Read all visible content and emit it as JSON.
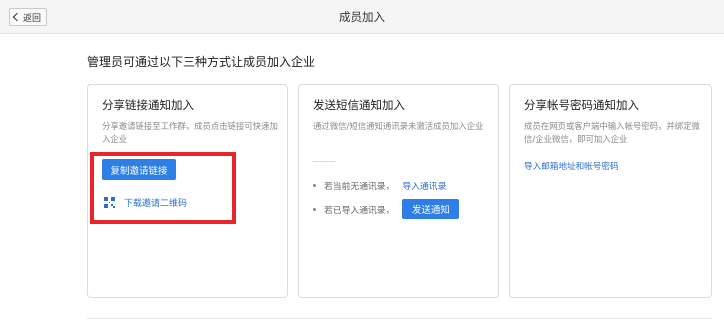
{
  "topbar": {
    "back_label": "返回",
    "title": "成员加入"
  },
  "heading": "管理员可通过以下三种方式让成员加入企业",
  "cards": [
    {
      "title": "分享链接通知加入",
      "desc": "分享邀请链接至工作群，成员点击链接可快速加入企业",
      "copy_button": "复制邀请链接",
      "qr_link": "下载邀请二维码"
    },
    {
      "title": "发送短信通知加入",
      "desc": "通过微信/短信通知通讯录未激活成员加入企业",
      "row1_text": "若当前无通讯录，",
      "row1_link": "导入通讯录",
      "row2_text": "若已导入通讯录，",
      "row2_button": "发送通知"
    },
    {
      "title": "分享帐号密码通知加入",
      "desc": "成员在网页或客户端中输入帐号密码，并绑定微信/企业微信，即可加入企业",
      "link": "导入邮箱地址和帐号密码"
    }
  ],
  "colors": {
    "primary": "#2d7ee6",
    "link": "#2d6fd1",
    "highlight": "#e8252b"
  },
  "icons": {
    "back": "chevron-left-icon",
    "qr": "qr-code-icon"
  }
}
